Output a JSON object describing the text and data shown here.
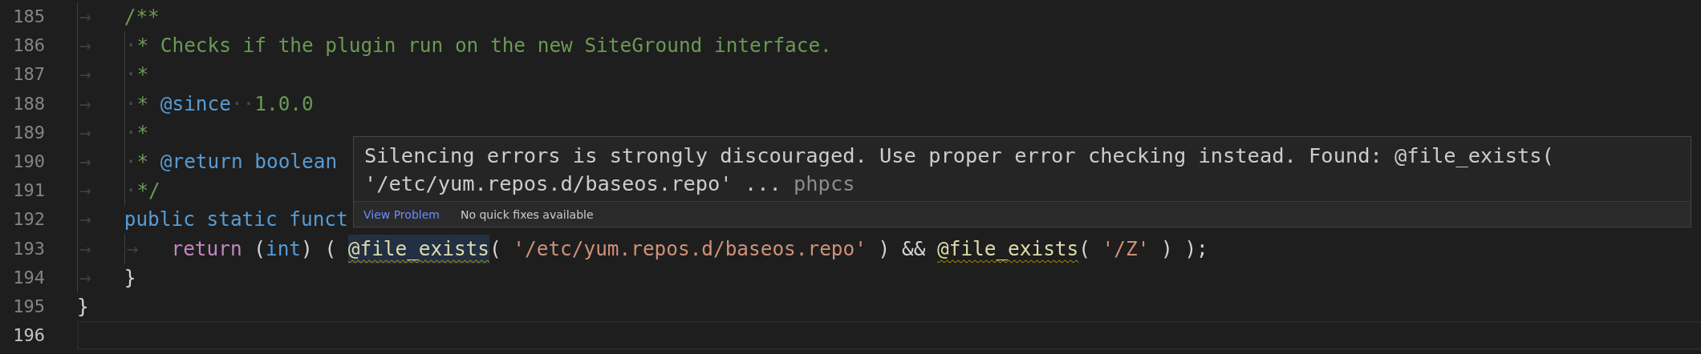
{
  "editor": {
    "lines": [
      {
        "number": "185",
        "current": false,
        "tokens": [
          {
            "kind": "tab",
            "text": "→"
          },
          {
            "kind": "comment",
            "text": "/**"
          }
        ]
      },
      {
        "number": "186",
        "current": false,
        "tokens": [
          {
            "kind": "tab",
            "text": "→"
          },
          {
            "kind": "lead",
            "text": "·"
          },
          {
            "kind": "comment",
            "text": "* Checks if the plugin run on the new SiteGround interface."
          }
        ]
      },
      {
        "number": "187",
        "current": false,
        "tokens": [
          {
            "kind": "tab",
            "text": "→"
          },
          {
            "kind": "lead",
            "text": "·"
          },
          {
            "kind": "comment",
            "text": "*"
          }
        ]
      },
      {
        "number": "188",
        "current": false,
        "tokens": [
          {
            "kind": "tab",
            "text": "→"
          },
          {
            "kind": "lead",
            "text": "·"
          },
          {
            "kind": "comment",
            "text": "* "
          },
          {
            "kind": "doctag",
            "text": "@since"
          },
          {
            "kind": "ws",
            "text": "··"
          },
          {
            "kind": "comment",
            "text": "1.0.0"
          }
        ]
      },
      {
        "number": "189",
        "current": false,
        "tokens": [
          {
            "kind": "tab",
            "text": "→"
          },
          {
            "kind": "lead",
            "text": "·"
          },
          {
            "kind": "comment",
            "text": "*"
          }
        ]
      },
      {
        "number": "190",
        "current": false,
        "tokens": [
          {
            "kind": "tab",
            "text": "→"
          },
          {
            "kind": "lead",
            "text": "·"
          },
          {
            "kind": "comment",
            "text": "* "
          },
          {
            "kind": "doctag",
            "text": "@return"
          },
          {
            "kind": "type",
            "text": " boolean"
          }
        ]
      },
      {
        "number": "191",
        "current": false,
        "tokens": [
          {
            "kind": "tab",
            "text": "→"
          },
          {
            "kind": "lead",
            "text": "·"
          },
          {
            "kind": "comment",
            "text": "*/"
          }
        ]
      },
      {
        "number": "192",
        "current": false,
        "tokens": [
          {
            "kind": "tab",
            "text": "→"
          },
          {
            "kind": "keyword",
            "text": "public static funct"
          }
        ]
      },
      {
        "number": "193",
        "current": false,
        "tokens": [
          {
            "kind": "tab",
            "text": "→"
          },
          {
            "kind": "tab",
            "text": "→"
          },
          {
            "kind": "control",
            "text": "return"
          },
          {
            "kind": "punct",
            "text": " ("
          },
          {
            "kind": "type",
            "text": "int"
          },
          {
            "kind": "punct",
            "text": ") ( "
          },
          {
            "kind": "func",
            "text": "@file_exists",
            "warning": true,
            "highlighted": true
          },
          {
            "kind": "punct",
            "text": "( "
          },
          {
            "kind": "string",
            "text": "'/etc/yum.repos.d/baseos.repo'"
          },
          {
            "kind": "punct",
            "text": " ) && "
          },
          {
            "kind": "func",
            "text": "@file_exists",
            "warning": true,
            "highlighted": false
          },
          {
            "kind": "punct",
            "text": "( "
          },
          {
            "kind": "string",
            "text": "'/Z'"
          },
          {
            "kind": "punct",
            "text": " ) );"
          }
        ]
      },
      {
        "number": "194",
        "current": false,
        "tokens": [
          {
            "kind": "tab",
            "text": "→"
          },
          {
            "kind": "punct",
            "text": "}"
          }
        ]
      },
      {
        "number": "195",
        "current": false,
        "tokens": [
          {
            "kind": "punct",
            "text": "}"
          }
        ]
      },
      {
        "number": "196",
        "current": true
      }
    ]
  },
  "hover": {
    "message": "Silencing errors is strongly discouraged. Use proper error checking instead. Found: @file_exists( '/etc/yum.repos.d/baseos.repo' ...",
    "source": "phpcs",
    "actions": [
      {
        "kind": "link",
        "label": "View Problem"
      },
      {
        "kind": "note",
        "label": "No quick fixes available"
      }
    ]
  }
}
